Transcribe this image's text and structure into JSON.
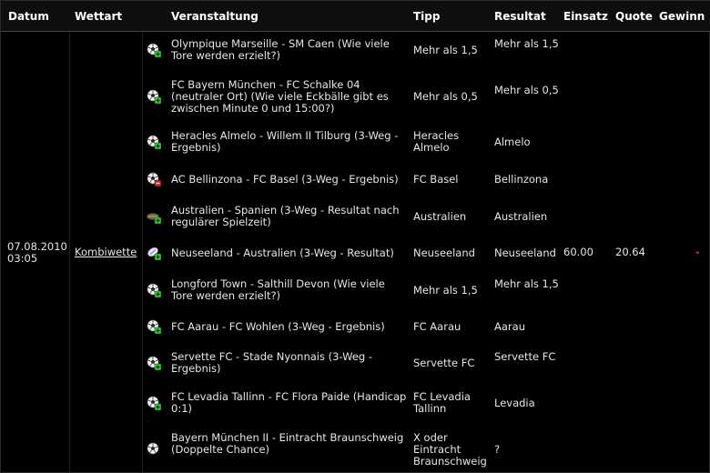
{
  "headers": {
    "datum": "Datum",
    "wettart": "Wettart",
    "veranstaltung": "Veranstaltung",
    "tipp": "Tipp",
    "resultat": "Resultat",
    "einsatz": "Einsatz",
    "quote": "Quote",
    "gewinn": "Gewinn"
  },
  "bet": {
    "date": "07.08.2010",
    "time": "03:05",
    "type": "Kombiwette",
    "stake": "60.00",
    "odds": "20.64",
    "win": "-"
  },
  "colors": {
    "background": "#000000",
    "header_bg": "#0e0e0e",
    "text": "#e6e6e6",
    "loss": "#e03030",
    "win_badge": "#33cc33",
    "loss_badge": "#cc2222"
  },
  "rows": [
    {
      "event": "Olympique Marseille - SM Caen (Wie viele Tore werden erzielt?)",
      "tip": "Mehr als 1,5",
      "result": "Mehr als 1,5",
      "icon": "soccer-ball-win-icon"
    },
    {
      "event": "FC Bayern München - FC Schalke 04 (neutraler Ort) (Wie viele Eckbälle gibt es zwischen Minute 0 und 15:00?)",
      "tip": "Mehr als 0,5",
      "result": "Mehr als 0,5",
      "icon": "soccer-ball-win-icon"
    },
    {
      "event": "Heracles Almelo - Willem II Tilburg (3-Weg - Ergebnis)",
      "tip": "Heracles Almelo",
      "result": "Almelo",
      "icon": "soccer-ball-win-icon"
    },
    {
      "event": "AC Bellinzona - FC Basel (3-Weg - Ergebnis)",
      "tip": "FC Basel",
      "result": "Bellinzona",
      "icon": "soccer-ball-loss-icon"
    },
    {
      "event": "Australien - Spanien (3-Weg - Resultat nach regulärer Spielzeit)",
      "tip": "Australien",
      "result": "Australien",
      "icon": "field-win-icon"
    },
    {
      "event": "Neuseeland - Australien (3-Weg - Resultat)",
      "tip": "Neuseeland",
      "result": "Neuseeland",
      "icon": "rugby-ball-win-icon"
    },
    {
      "event": "Longford Town - Salthill Devon (Wie viele Tore werden erzielt?)",
      "tip": "Mehr als 1,5",
      "result": "Mehr als 1,5",
      "icon": "soccer-ball-win-icon"
    },
    {
      "event": "FC Aarau - FC Wohlen (3-Weg - Ergebnis)",
      "tip": "FC Aarau",
      "result": "Aarau",
      "icon": "soccer-ball-win-icon"
    },
    {
      "event": "Servette FC - Stade Nyonnais (3-Weg - Ergebnis)",
      "tip": "Servette FC",
      "result": "Servette FC",
      "icon": "soccer-ball-win-icon"
    },
    {
      "event": "FC Levadia Tallinn - FC Flora Paide (Handicap 0:1)",
      "tip": "FC Levadia Tallinn",
      "result": "Levadia",
      "icon": "soccer-ball-win-icon"
    },
    {
      "event": "Bayern München II - Eintracht Braunschweig (Doppelte Chance)",
      "tip": "X oder Eintracht Braunschweig",
      "result": "?",
      "icon": "soccer-ball-icon"
    }
  ]
}
